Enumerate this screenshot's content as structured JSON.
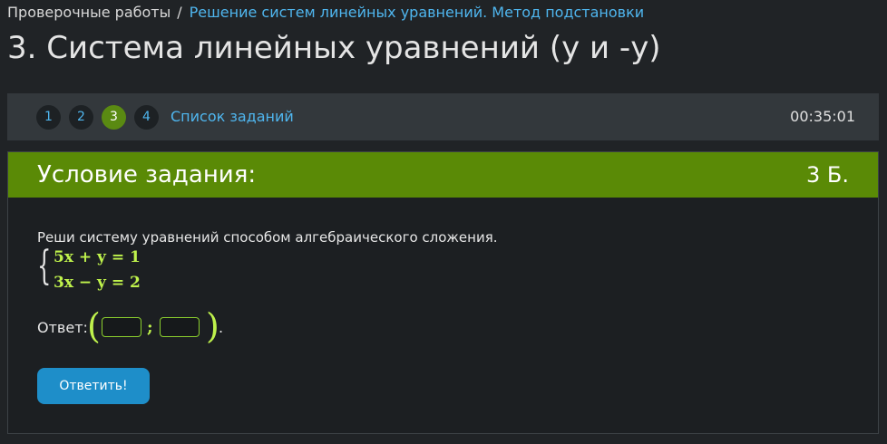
{
  "breadcrumb": {
    "root": "Проверочные работы",
    "separator": "/",
    "current": "Решение систем линейных уравнений. Метод подстановки"
  },
  "page": {
    "title": "3. Система линейных уравнений (y и -y)"
  },
  "task_nav": {
    "numbers": [
      {
        "label": "1",
        "active": false
      },
      {
        "label": "2",
        "active": false
      },
      {
        "label": "3",
        "active": true
      },
      {
        "label": "4",
        "active": false
      }
    ],
    "task_list_label": "Список заданий",
    "timer": "00:35:01"
  },
  "task": {
    "header": "Условие задания:",
    "points": "3 Б.",
    "instruction": "Реши систему уравнений способом алгебраического сложения.",
    "brace": "{",
    "equations": [
      "5x + y = 1",
      "3x − y = 2"
    ],
    "answer_label": "Ответ:",
    "paren_left": "(",
    "paren_right": ")",
    "semicolon": ";",
    "period": ".",
    "answer_x_value": "",
    "answer_y_value": "",
    "submit_label": "Ответить!"
  },
  "colors": {
    "page_background": "#202326",
    "link": "#4fb6ef",
    "header_green": "#5a8a06",
    "active_number": "#5a8a12",
    "math_green": "#bff24c",
    "submit_button": "#1e8ec9"
  }
}
